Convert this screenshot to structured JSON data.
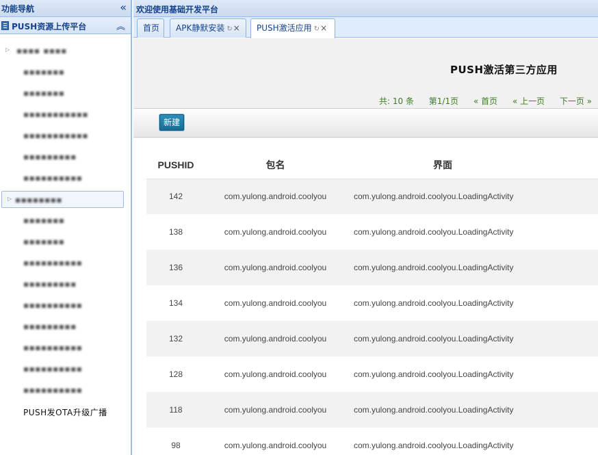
{
  "nav": {
    "title": "功能导航",
    "collapse_icon": "«",
    "group": {
      "title": "PUSH资源上传平台",
      "toggle_icon": "︽"
    },
    "items": [
      {
        "label": "▪▪▪▪ ▪▪▪▪",
        "blurred": true,
        "folder": true
      },
      {
        "label": "▪▪▪▪▪▪▪",
        "blurred": true,
        "folder": false
      },
      {
        "label": "▪▪▪▪▪▪▪",
        "blurred": true,
        "folder": false
      },
      {
        "label": "▪▪▪▪▪▪▪▪▪▪▪",
        "blurred": true,
        "folder": false
      },
      {
        "label": "▪▪▪▪▪▪▪▪▪▪▪",
        "blurred": true,
        "folder": false
      },
      {
        "label": "▪▪▪▪▪▪▪▪▪",
        "blurred": true,
        "folder": false
      },
      {
        "label": "▪▪▪▪▪▪▪▪▪▪",
        "blurred": true,
        "folder": false
      },
      {
        "label": "▪▪▪▪▪▪▪▪",
        "blurred": true,
        "folder": true,
        "selected": true
      },
      {
        "label": "▪▪▪▪▪▪▪",
        "blurred": true,
        "folder": false
      },
      {
        "label": "▪▪▪▪▪▪▪",
        "blurred": true,
        "folder": false
      },
      {
        "label": "▪▪▪▪▪▪▪▪▪▪",
        "blurred": true,
        "folder": false
      },
      {
        "label": "▪▪▪▪▪▪▪▪▪",
        "blurred": true,
        "folder": false
      },
      {
        "label": "▪▪▪▪▪▪▪▪▪▪",
        "blurred": true,
        "folder": false
      },
      {
        "label": "▪▪▪▪▪▪▪▪▪",
        "blurred": true,
        "folder": false
      },
      {
        "label": "▪▪▪▪▪▪▪▪▪▪",
        "blurred": true,
        "folder": false
      },
      {
        "label": "▪▪▪▪▪▪▪▪▪▪",
        "blurred": true,
        "folder": false
      },
      {
        "label": "▪▪▪▪▪▪▪▪▪▪",
        "blurred": true,
        "folder": false
      },
      {
        "label": "PUSH发OTA升级广播",
        "blurred": false,
        "folder": false
      }
    ]
  },
  "header": {
    "welcome": "欢迎使用基础开发平台"
  },
  "tabs": [
    {
      "label": "首页",
      "closable": false,
      "active": false
    },
    {
      "label": "APK静默安装",
      "closable": true,
      "active": false
    },
    {
      "label": "PUSH激活应用",
      "closable": true,
      "active": true
    }
  ],
  "tab_icons": {
    "refresh": "↻",
    "close": "×"
  },
  "page": {
    "heading": "PUSH激活第三方应用",
    "pager": {
      "total": "共: 10 条",
      "page": "第1/1页",
      "first": "« 首页",
      "prev": "« 上一页",
      "next": "下一页 »"
    },
    "new_button": "新建"
  },
  "table": {
    "headers": [
      "PUSHID",
      "包名",
      "界面"
    ],
    "rows": [
      [
        "142",
        "com.yulong.android.coolyou",
        "com.yulong.android.coolyou.LoadingActivity"
      ],
      [
        "138",
        "com.yulong.android.coolyou",
        "com.yulong.android.coolyou.LoadingActivity"
      ],
      [
        "136",
        "com.yulong.android.coolyou",
        "com.yulong.android.coolyou.LoadingActivity"
      ],
      [
        "134",
        "com.yulong.android.coolyou",
        "com.yulong.android.coolyou.LoadingActivity"
      ],
      [
        "132",
        "com.yulong.android.coolyou",
        "com.yulong.android.coolyou.LoadingActivity"
      ],
      [
        "128",
        "com.yulong.android.coolyou",
        "com.yulong.android.coolyou.LoadingActivity"
      ],
      [
        "118",
        "com.yulong.android.coolyou",
        "com.yulong.android.coolyou.LoadingActivity"
      ],
      [
        "98",
        "com.yulong.android.coolyou",
        "com.yulong.android.coolyou.LoadingActivity"
      ]
    ]
  },
  "colors": {
    "accent": "#15428b",
    "pager_green": "#3c7e1c",
    "button": "#1b6c94"
  }
}
